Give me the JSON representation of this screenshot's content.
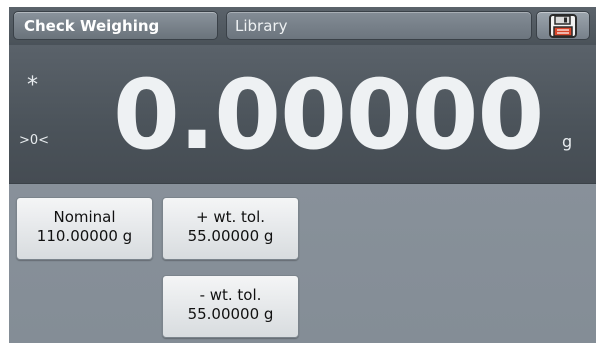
{
  "header": {
    "app_title": "Check Weighing",
    "library_label": "Library",
    "save_icon": "floppy-disk-icon"
  },
  "display": {
    "stable_indicator": "*",
    "zero_indicator": ">0<",
    "weight": "0.00000",
    "unit": "g"
  },
  "parameters": {
    "nominal": {
      "label": "Nominal",
      "value": "110.00000 g"
    },
    "plus_tolerance": {
      "label": "+ wt. tol.",
      "value": "55.00000 g"
    },
    "minus_tolerance": {
      "label": "- wt. tol.",
      "value": "55.00000 g"
    }
  },
  "colors": {
    "header_bg": "#4f575e",
    "display_bg": "#4b535a",
    "body_bg": "#8a939c",
    "button_bg": "#e6e8ea",
    "save_icon_accent": "#d9462b"
  }
}
